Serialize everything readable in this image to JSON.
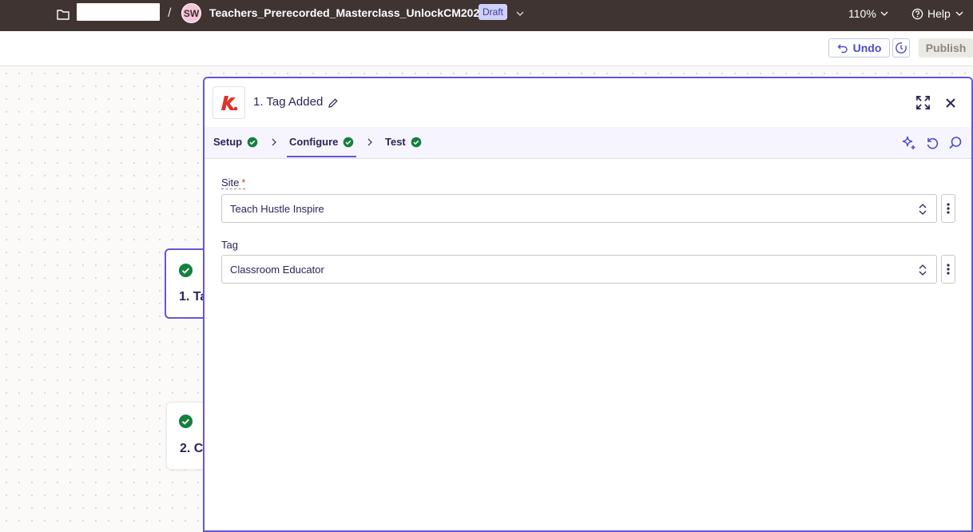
{
  "topbar": {
    "zap_title": "Teachers_Prerecorded_Masterclass_UnlockCM2025",
    "separator": "/",
    "avatar_initials": "SW",
    "status_badge": "Draft",
    "zoom": "110%",
    "help_label": "Help",
    "background_color": "#403433"
  },
  "toolbar": {
    "undo_label": "Undo",
    "publish_label": "Publish"
  },
  "canvas": {
    "nodes": [
      {
        "label": "1. Ta",
        "status": "success"
      },
      {
        "label": "2. C",
        "status": "success"
      }
    ]
  },
  "panel": {
    "step_title": "1. Tag Added",
    "app_logo_letter": "k",
    "accent_color": "#6556d6",
    "tabs": [
      {
        "label": "Setup",
        "complete": true
      },
      {
        "label": "Configure",
        "complete": true,
        "active": true
      },
      {
        "label": "Test",
        "complete": true
      }
    ],
    "fields": [
      {
        "label": "Site",
        "required": "*",
        "value": "Teach Hustle Inspire"
      },
      {
        "label": "Tag",
        "value": "Classroom Educator"
      }
    ]
  },
  "icons": {
    "folder": "folder-icon",
    "check": "check-circle-icon",
    "edit": "pencil-icon",
    "expand": "expand-icon",
    "close": "close-icon",
    "ai": "sparkle-icon",
    "reset": "undo-circle-icon",
    "search": "search-icon",
    "history": "history-icon"
  },
  "colors": {
    "success_green": "#15803d",
    "required_red": "#d6402f"
  }
}
